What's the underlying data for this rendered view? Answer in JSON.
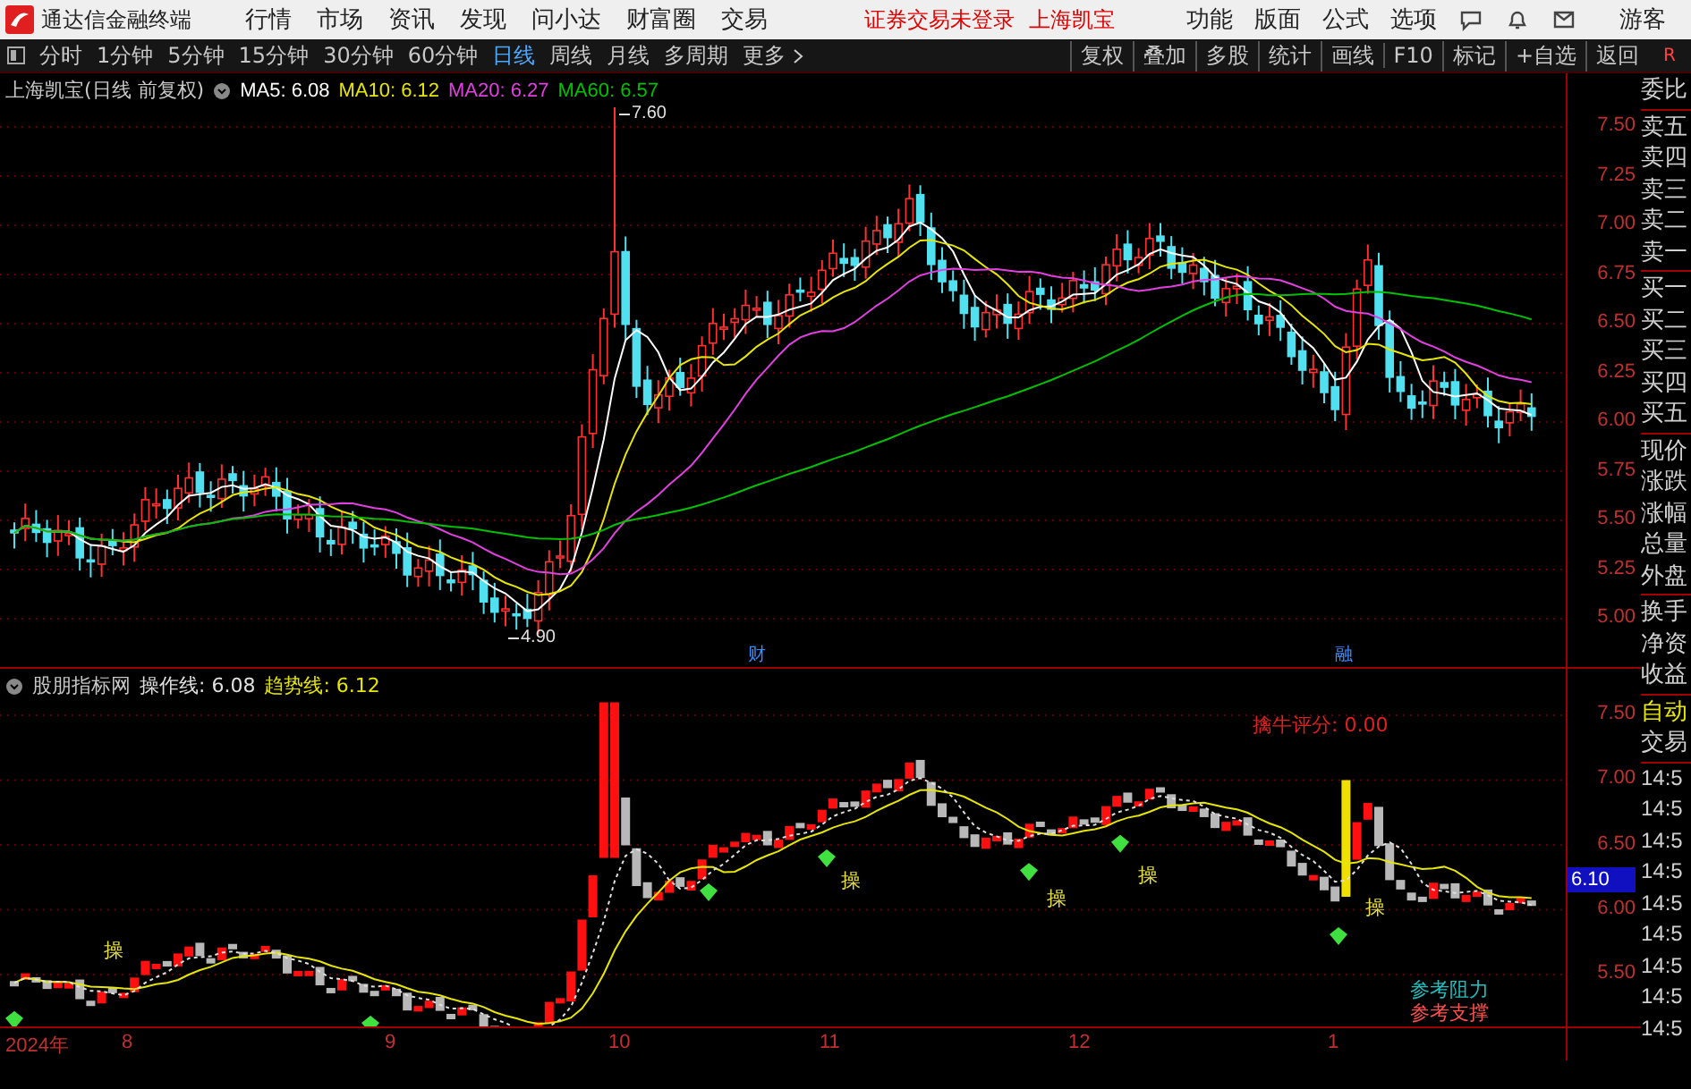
{
  "menu_bar": {
    "app_title": "通达信金融终端",
    "menus": [
      "行情",
      "市场",
      "资讯",
      "发现",
      "问小达",
      "财富圈",
      "交易"
    ],
    "trade_status": "证券交易未登录",
    "stock_name": "上海凯宝",
    "right_menus": [
      "功能",
      "版面",
      "公式",
      "选项"
    ],
    "user": "游客"
  },
  "toolbar": {
    "periods": [
      {
        "label": "分时",
        "selected": false
      },
      {
        "label": "1分钟",
        "selected": false
      },
      {
        "label": "5分钟",
        "selected": false
      },
      {
        "label": "15分钟",
        "selected": false
      },
      {
        "label": "30分钟",
        "selected": false
      },
      {
        "label": "60分钟",
        "selected": false
      },
      {
        "label": "日线",
        "selected": true
      },
      {
        "label": "周线",
        "selected": false
      },
      {
        "label": "月线",
        "selected": false
      },
      {
        "label": "多周期",
        "selected": false
      }
    ],
    "more": "更多",
    "buttons": [
      "复权",
      "叠加",
      "多股",
      "统计",
      "画线",
      "F10",
      "标记",
      "+自选",
      "返回"
    ],
    "corner": "R"
  },
  "main_chart": {
    "title": "上海凯宝(日线 前复权)",
    "moving_averages": [
      {
        "label": "MA5: 6.08",
        "color": "#ffffff"
      },
      {
        "label": "MA10: 6.12",
        "color": "#e6e600"
      },
      {
        "label": "MA20: 6.27",
        "color": "#e040e0"
      },
      {
        "label": "MA60: 6.57",
        "color": "#00c000"
      }
    ],
    "high_marker": "7.60",
    "low_marker": "4.90",
    "event_marks": [
      "财",
      "融"
    ],
    "price_ticks": [
      "7.50",
      "7.25",
      "7.00",
      "6.75",
      "6.50",
      "6.25",
      "6.00",
      "5.75",
      "5.50",
      "5.25",
      "5.00"
    ]
  },
  "indicator": {
    "name": "股朋指标网",
    "lines": [
      {
        "label": "操作线: 6.08",
        "color": "#e0e0e0"
      },
      {
        "label": "趋势线: 6.12",
        "color": "#e6e600"
      }
    ],
    "score": "擒牛评分: 0.00",
    "signal_marks": [
      "操",
      "操",
      "操",
      "操",
      "操"
    ],
    "legend": [
      {
        "label": "参考阻力",
        "color": "#20c0c0"
      },
      {
        "label": "参考支撑",
        "color": "#ff5050"
      }
    ],
    "price_ticks": [
      "7.50",
      "7.00",
      "6.50",
      "6.00",
      "5.50"
    ],
    "current_value": "6.10"
  },
  "date_axis": [
    "2024年",
    "8",
    "9",
    "10",
    "11",
    "12",
    "1"
  ],
  "quote_panel": {
    "groups": [
      [
        "委比"
      ],
      [
        "卖五",
        "卖四",
        "卖三",
        "卖二",
        "卖一"
      ],
      [
        "买一",
        "买二",
        "买三",
        "买四",
        "买五"
      ],
      [
        "现价",
        "涨跌",
        "涨幅",
        "总量",
        "外盘"
      ],
      [
        "换手",
        "净资",
        "收益"
      ]
    ],
    "auto_trade": [
      "自动",
      "交易"
    ],
    "times": [
      "14:5",
      "14:5",
      "14:5",
      "14:5",
      "14:5",
      "14:5",
      "14:5",
      "14:5",
      "14:5"
    ]
  }
}
